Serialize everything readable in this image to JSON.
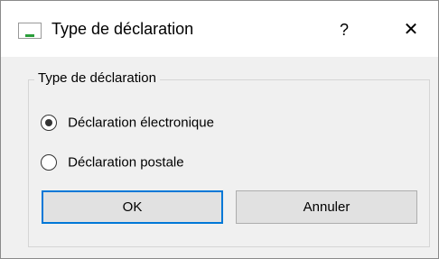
{
  "window": {
    "title": "Type de déclaration",
    "icon": "app-logo-icon",
    "help_label": "?",
    "close_label": "✕"
  },
  "group": {
    "legend": "Type de déclaration",
    "options": [
      {
        "label": "Déclaration électronique",
        "selected": true
      },
      {
        "label": "Déclaration postale",
        "selected": false
      }
    ]
  },
  "buttons": {
    "ok_label": "OK",
    "cancel_label": "Annuler"
  },
  "colors": {
    "focus_border": "#0078d7",
    "button_face": "#e1e1e1",
    "dialog_background": "#f0f0f0"
  }
}
